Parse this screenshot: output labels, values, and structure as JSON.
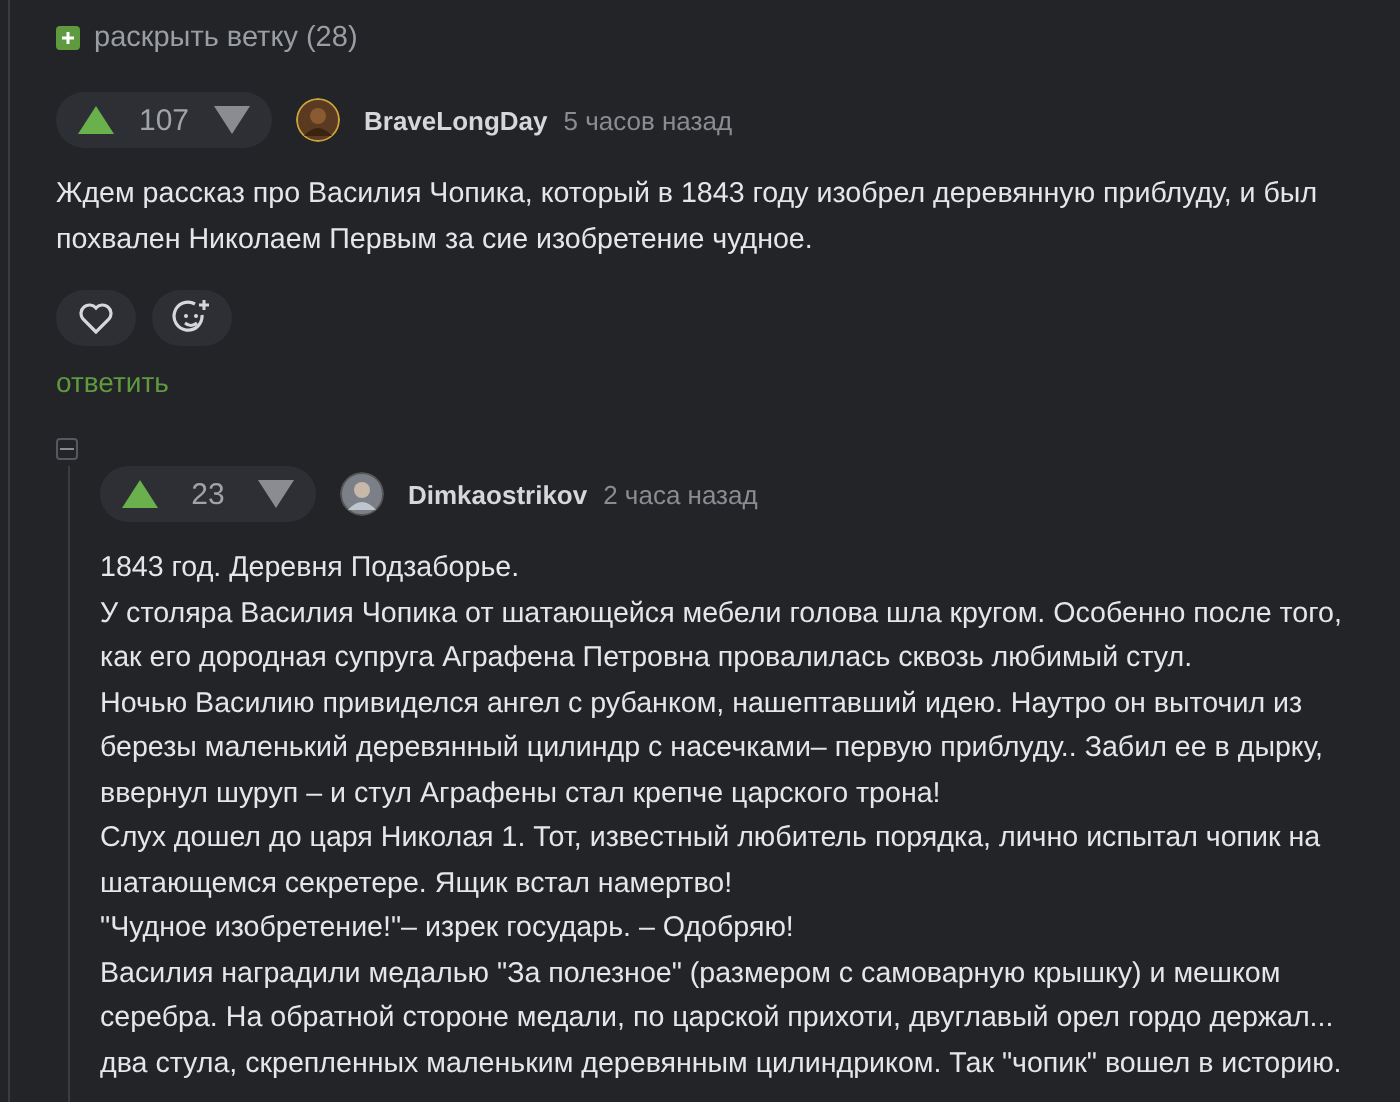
{
  "expand_branch": {
    "label": "раскрыть ветку (28)"
  },
  "comments": [
    {
      "rating": "107",
      "author": "BraveLongDay",
      "time": "5 часов назад",
      "paragraphs": [
        "Ждем рассказ про Василия Чопика, который в 1843 году изобрел деревянную приблуду, и был похвален Николаем Первым за сие изобретение чудное."
      ],
      "reply_link": "ответить"
    },
    {
      "rating": "23",
      "author": "Dimkaostrikov",
      "time": "2 часа назад",
      "collapsible": true,
      "paragraphs": [
        "1843 год. Деревня Подзаборье.",
        "У столяра Василия Чопика от шатающейся мебели голова шла кругом. Особенно после того, как его дородная супруга Аграфена Петровна провалилась сквозь любимый стул.",
        "Ночью Василию привиделся ангел с рубанком, нашептавший идею. Наутро он выточил из березы маленький деревянный цилиндр с насечками– первую приблуду.. Забил ее в дырку, ввернул шуруп – и стул Аграфены стал крепче царского трона!",
        "Слух дошел до царя Николая 1. Тот, известный любитель порядка, лично испытал чопик на шатающемся секретере. Ящик встал намертво!",
        "\"Чудное изобретение!\"– изрек государь. – Одобряю!",
        "Василия наградили медалью \"За полезное\" (размером с самоварную крышку) и мешком серебра. На обратной стороне медали, по царской прихоти, двуглавый орел гордо держал... два стула, скрепленных маленьким деревянным цилиндриком. Так \"чопик\" вошел в историю."
      ]
    }
  ]
}
